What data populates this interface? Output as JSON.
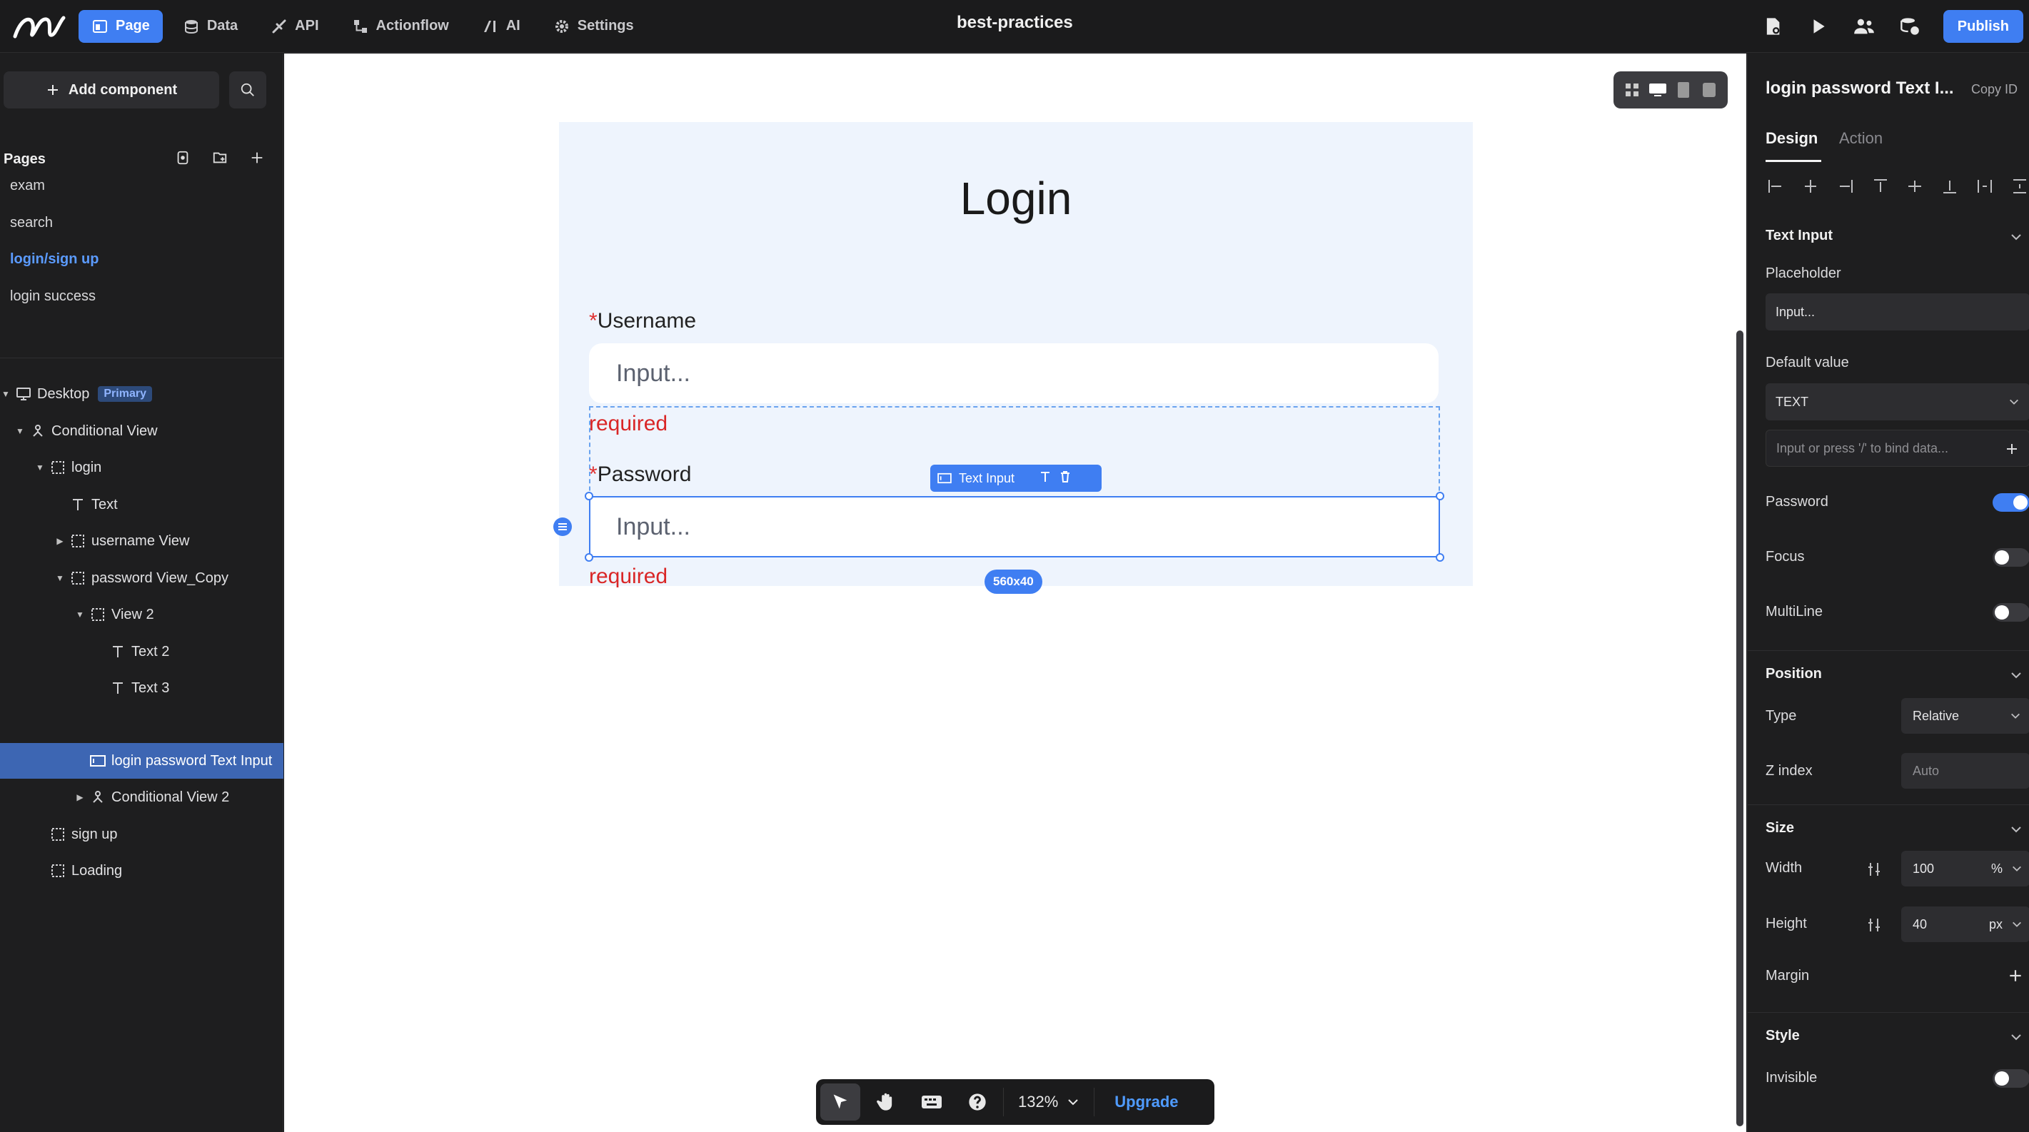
{
  "app": {
    "doc_title": "best-practices",
    "publish_label": "Publish",
    "nav": [
      {
        "label": "Page",
        "icon": "page-icon",
        "active": true
      },
      {
        "label": "Data",
        "icon": "database-icon"
      },
      {
        "label": "API",
        "icon": "api-icon"
      },
      {
        "label": "Actionflow",
        "icon": "flow-icon"
      },
      {
        "label": "AI",
        "icon": "ai-icon"
      },
      {
        "label": "Settings",
        "icon": "gear-icon"
      }
    ],
    "accent_color": "#3f7ef2"
  },
  "left_panel": {
    "add_component_label": "Add component",
    "pages_header": "Pages",
    "pages": [
      "exam",
      "search",
      "login/sign up",
      "login success"
    ],
    "active_page": "login/sign up",
    "tree": [
      {
        "label": "Desktop",
        "badge": "Primary"
      },
      {
        "label": "Conditional View"
      },
      {
        "label": "login"
      },
      {
        "label": "Text"
      },
      {
        "label": "username View"
      },
      {
        "label": "password View_Copy"
      },
      {
        "label": "View 2"
      },
      {
        "label": "Text 2"
      },
      {
        "label": "Text 3"
      },
      {
        "label": "login password Text Input"
      },
      {
        "label": "Conditional View 2"
      },
      {
        "label": "sign up"
      },
      {
        "label": "Loading"
      }
    ]
  },
  "canvas": {
    "login_title": "Login",
    "username_label": "Username",
    "password_label": "Password",
    "required_mark": "*",
    "input_placeholder": "Input...",
    "required_text": "required",
    "component_tag": "Text Input",
    "size_tag": "560x40",
    "zoom_level": "132%",
    "upgrade_label": "Upgrade"
  },
  "right_panel": {
    "title": "login password Text I...",
    "copy_id": "Copy ID",
    "tabs": [
      "Design",
      "Action"
    ],
    "text_input_section": "Text Input",
    "placeholder_label": "Placeholder",
    "placeholder_value": "Input...",
    "default_value_label": "Default value",
    "default_value_type": "TEXT",
    "bind_placeholder": "Input or press '/' to bind data...",
    "password_label": "Password",
    "password_on": true,
    "focus_label": "Focus",
    "focus_on": false,
    "multiline_label": "MultiLine",
    "multiline_on": false,
    "position_section": "Position",
    "type_label": "Type",
    "type_value": "Relative",
    "zindex_label": "Z index",
    "zindex_value": "Auto",
    "size_section": "Size",
    "width_label": "Width",
    "width_value": "100",
    "width_unit": "%",
    "height_label": "Height",
    "height_value": "40",
    "height_unit": "px",
    "margin_label": "Margin",
    "style_section": "Style",
    "invisible_label": "Invisible",
    "invisible_on": false
  }
}
